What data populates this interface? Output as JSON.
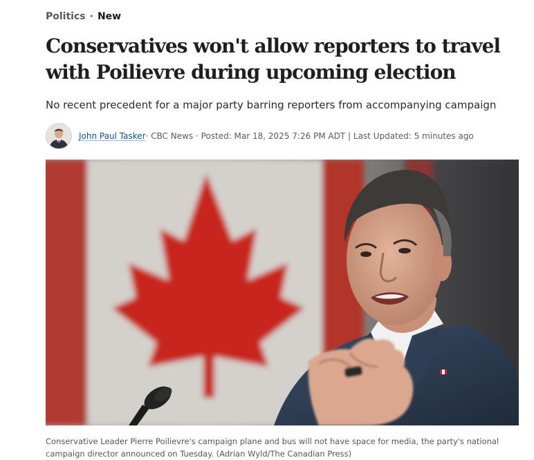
{
  "breadcrumb": {
    "section": "Politics",
    "separator": "·",
    "badge": "New"
  },
  "article": {
    "headline": "Conservatives won't allow reporters to travel with Poilievre during upcoming election",
    "deck": "No recent precedent for a major party barring reporters from accompanying campaign",
    "byline": {
      "author": "John Paul Tasker",
      "meta": " · CBC News · Posted: Mar 18, 2025 7:26 PM ADT | Last Updated: 5 minutes ago"
    },
    "photo": {
      "caption": "Conservative Leader Pierre Poilievre's campaign plane and bus will not have space for media, the party's national campaign director announced on Tuesday. (Adrian Wyld/The Canadian Press)"
    }
  },
  "colors": {
    "link": "#0b4f9c",
    "flag_red": "#c8261f",
    "text": "#1f1f1f",
    "muted": "#5a5a5a"
  }
}
